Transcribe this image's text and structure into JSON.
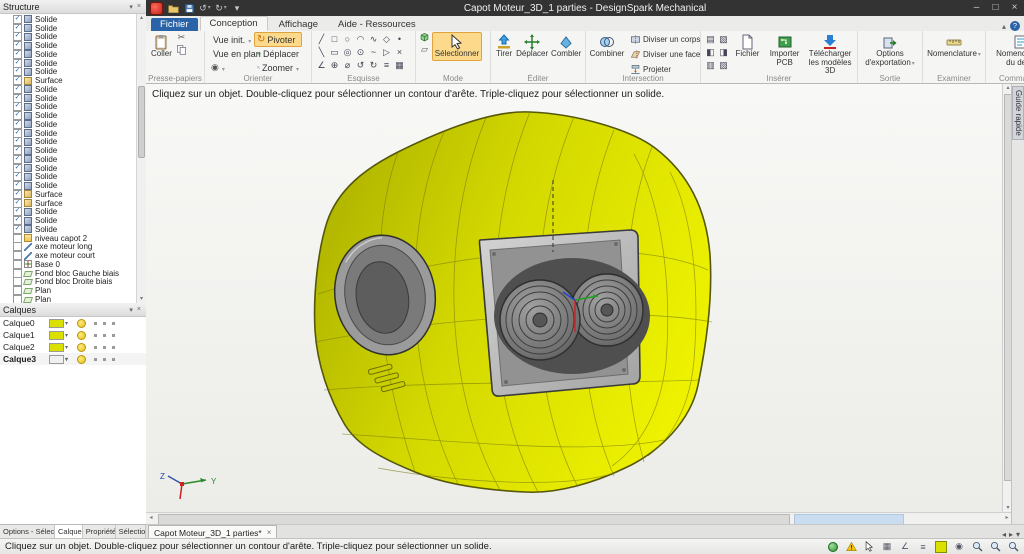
{
  "window": {
    "title": "Capot Moteur_3D_1 parties - DesignSpark Mechanical",
    "controls": {
      "minimize": "–",
      "maximize": "□",
      "close": "×"
    }
  },
  "quick_access": {
    "icons": [
      {
        "name": "app-logo-icon",
        "type": "logo"
      },
      {
        "name": "open-file-icon",
        "type": "sym",
        "sym": "folder"
      },
      {
        "name": "save-icon",
        "type": "sym",
        "sym": "disk"
      },
      {
        "name": "undo-icon",
        "type": "glyph",
        "glyph": "↺",
        "dd": true
      },
      {
        "name": "redo-icon",
        "type": "glyph",
        "glyph": "↻",
        "dd": true
      },
      {
        "name": "customize-quick-access-icon",
        "type": "glyph",
        "glyph": "▾"
      }
    ]
  },
  "ribbon": {
    "tabs": [
      {
        "label": "Fichier",
        "style": "file",
        "active": false
      },
      {
        "label": "Conception",
        "active": true
      },
      {
        "label": "Affichage",
        "active": false
      },
      {
        "label": "Aide - Ressources",
        "active": false
      }
    ],
    "collapse_icon": "▴",
    "help_icon": "?",
    "groups": {
      "clipboard": {
        "label": "Presse-papiers",
        "paste_label": "Coller",
        "cut_icon": "✂"
      },
      "orient": {
        "label": "Orienter",
        "buttons": [
          {
            "label": "Vue init."
          },
          {
            "label": "Pivoter"
          },
          {
            "label": "Vue en plan"
          },
          {
            "label": "Déplacer"
          },
          {
            "label": "Zoomer"
          }
        ],
        "extra_icon": "◉"
      },
      "sketch": {
        "label": "Esquisse",
        "tools": [
          {
            "name": "line-tool-icon",
            "glyph": "╱"
          },
          {
            "name": "rectangle-tool-icon",
            "glyph": "□"
          },
          {
            "name": "circle-tool-icon",
            "glyph": "○"
          },
          {
            "name": "arc-tool-icon",
            "glyph": "◠"
          },
          {
            "name": "spline-tool-icon",
            "glyph": "∿"
          },
          {
            "name": "polygon-tool-icon",
            "glyph": "◇"
          },
          {
            "name": "point-tool-icon",
            "glyph": "•"
          },
          {
            "name": "construction-line-tool-icon",
            "glyph": "╲"
          },
          {
            "name": "three-point-rectangle-tool-icon",
            "glyph": "▭"
          },
          {
            "name": "concentric-circle-tool-icon",
            "glyph": "◎"
          },
          {
            "name": "reference-circle-tool-icon",
            "glyph": "⊙"
          },
          {
            "name": "tangent-line-tool-icon",
            "glyph": "~"
          },
          {
            "name": "tangent-arc-tool-icon",
            "glyph": "▷"
          },
          {
            "name": "trim-tool-icon",
            "glyph": "×"
          },
          {
            "name": "angle-tool-icon",
            "glyph": "∠"
          },
          {
            "name": "offset-tool-icon",
            "glyph": "⊕"
          },
          {
            "name": "diameter-tool-icon",
            "glyph": "⌀"
          },
          {
            "name": "undo-sketch-tool-icon",
            "glyph": "↺"
          },
          {
            "name": "redo-sketch-tool-icon",
            "glyph": "↻"
          },
          {
            "name": "equal-constraint-tool-icon",
            "glyph": "≡"
          },
          {
            "name": "grid-tool-icon",
            "glyph": "▦"
          }
        ]
      },
      "mode": {
        "label": "Mode",
        "select_label": "Sélectionner",
        "sketch_mode_icon": "▱"
      },
      "edit": {
        "label": "Éditer",
        "buttons": [
          {
            "label": "Tirer"
          },
          {
            "label": "Déplacer"
          },
          {
            "label": "Combler"
          }
        ]
      },
      "intersect": {
        "label": "Intersection",
        "combine_label": "Combiner",
        "buttons": [
          {
            "label": "Diviser un corps"
          },
          {
            "label": "Diviser une face"
          },
          {
            "label": "Projeter"
          }
        ]
      },
      "insert": {
        "label": "Insérer",
        "mini": [
          {
            "name": "insert-image-icon",
            "glyph": "▤"
          },
          {
            "name": "insert-note-icon",
            "glyph": "▧"
          },
          {
            "name": "insert-plane-icon",
            "glyph": "◧"
          },
          {
            "name": "insert-axis-icon",
            "glyph": "◨"
          },
          {
            "name": "insert-origin-icon",
            "glyph": "▥"
          },
          {
            "name": "insert-reference-icon",
            "glyph": "▨"
          }
        ],
        "buttons": [
          {
            "label": "Fichier"
          },
          {
            "label": "Importer PCB"
          },
          {
            "label": "Télécharger les modèles 3D"
          }
        ]
      },
      "output": {
        "label": "Sortie",
        "button_label": "Options d'exportation"
      },
      "examine": {
        "label": "Examiner",
        "button_label": "Nomenclature"
      },
      "order": {
        "label": "Commander",
        "button_label": "Nomenclature du devis"
      }
    }
  },
  "structure_panel": {
    "title": "Structure",
    "items": [
      {
        "label": "Solide",
        "icon": "solid",
        "checked": true
      },
      {
        "label": "Solide",
        "icon": "solid",
        "checked": true
      },
      {
        "label": "Solide",
        "icon": "solid",
        "checked": true
      },
      {
        "label": "Solide",
        "icon": "solid",
        "checked": true
      },
      {
        "label": "Solide",
        "icon": "solid",
        "checked": true
      },
      {
        "label": "Solide",
        "icon": "solid",
        "checked": true
      },
      {
        "label": "Solide",
        "icon": "solid",
        "checked": true
      },
      {
        "label": "Surface",
        "icon": "surface",
        "checked": true
      },
      {
        "label": "Solide",
        "icon": "solid",
        "checked": true
      },
      {
        "label": "Solide",
        "icon": "solid",
        "checked": true
      },
      {
        "label": "Solide",
        "icon": "solid",
        "checked": true
      },
      {
        "label": "Solide",
        "icon": "solid",
        "checked": true
      },
      {
        "label": "Solide",
        "icon": "solid",
        "checked": true
      },
      {
        "label": "Solide",
        "icon": "solid",
        "checked": true
      },
      {
        "label": "Solide",
        "icon": "solid",
        "checked": true
      },
      {
        "label": "Solide",
        "icon": "solid",
        "checked": true
      },
      {
        "label": "Solide",
        "icon": "solid",
        "checked": true
      },
      {
        "label": "Solide",
        "icon": "solid",
        "checked": true
      },
      {
        "label": "Solide",
        "icon": "solid",
        "checked": true
      },
      {
        "label": "Solide",
        "icon": "solid",
        "checked": true
      },
      {
        "label": "Surface",
        "icon": "surface",
        "checked": true
      },
      {
        "label": "Surface",
        "icon": "surface",
        "checked": true
      },
      {
        "label": "Solide",
        "icon": "solid",
        "checked": true
      },
      {
        "label": "Solide",
        "icon": "solid",
        "checked": true
      },
      {
        "label": "Solide",
        "icon": "solid",
        "checked": true
      },
      {
        "label": "niveau capot 2",
        "icon": "component",
        "checked": false
      },
      {
        "label": "axe moteur long",
        "icon": "axis",
        "checked": false
      },
      {
        "label": "axe moteur court",
        "icon": "axis",
        "checked": false
      },
      {
        "label": "Base 0",
        "icon": "origin",
        "checked": false
      },
      {
        "label": "Fond bloc Gauche biais",
        "icon": "plane",
        "checked": false
      },
      {
        "label": "Fond bloc Droite biais",
        "icon": "plane",
        "checked": false
      },
      {
        "label": "Plan",
        "icon": "plane",
        "checked": false
      },
      {
        "label": "Plan",
        "icon": "plane",
        "checked": false
      }
    ]
  },
  "layers_panel": {
    "title": "Calques",
    "rows": [
      {
        "name": "Calque0",
        "color": "#dce000",
        "selected": false
      },
      {
        "name": "Calque1",
        "color": "#dce000",
        "selected": false
      },
      {
        "name": "Calque2",
        "color": "#dce000",
        "selected": false
      },
      {
        "name": "Calque3",
        "color": "#f0f0f0",
        "selected": true
      }
    ]
  },
  "panel_tabs": [
    {
      "label": "Options - Sélection",
      "active": false
    },
    {
      "label": "Calques",
      "active": true
    },
    {
      "label": "Propriétés",
      "active": false
    },
    {
      "label": "Sélection",
      "active": false
    }
  ],
  "canvas": {
    "hint": "Cliquez sur un objet. Double-cliquez pour sélectionner un contour d'arête. Triple-cliquez pour sélectionner un solide.",
    "guide_tab": "Guide rapide",
    "axis_labels": {
      "y": "Y",
      "z": "Z"
    }
  },
  "document_tabs": {
    "tabs": [
      {
        "label": "Capot Moteur_3D_1 parties*",
        "active": true
      }
    ],
    "close_icon": "×"
  },
  "status_bar": {
    "message": "Cliquez sur un objet. Double-cliquez pour sélectionner un contour d'arête. Triple-cliquez pour sélectionner un solide.",
    "icons": [
      {
        "name": "connection-status-icon",
        "type": "dot"
      },
      {
        "name": "warning-icon",
        "type": "sym",
        "sym": "warning"
      },
      {
        "name": "cursor-mode-icon",
        "type": "sym",
        "sym": "cursor"
      },
      {
        "name": "grid-snap-icon",
        "type": "glyph",
        "glyph": "▦"
      },
      {
        "name": "angle-snap-icon",
        "type": "glyph",
        "glyph": "∠"
      },
      {
        "name": "align-snap-icon",
        "type": "glyph",
        "glyph": "≡"
      },
      {
        "name": "layer-color-icon",
        "type": "chip"
      },
      {
        "name": "magnet-snap-icon",
        "type": "glyph",
        "glyph": "◉"
      },
      {
        "name": "zoom-window-icon",
        "type": "sym",
        "sym": "zoom"
      },
      {
        "name": "zoom-extents-icon",
        "type": "sym",
        "sym": "zoom"
      },
      {
        "name": "zoom-selection-icon",
        "type": "sym",
        "sym": "zoom"
      }
    ]
  },
  "colors": {
    "model_yellow": "#d6da00",
    "highlight_orange": "#fcd98b",
    "file_tab_blue": "#2a63a8"
  }
}
